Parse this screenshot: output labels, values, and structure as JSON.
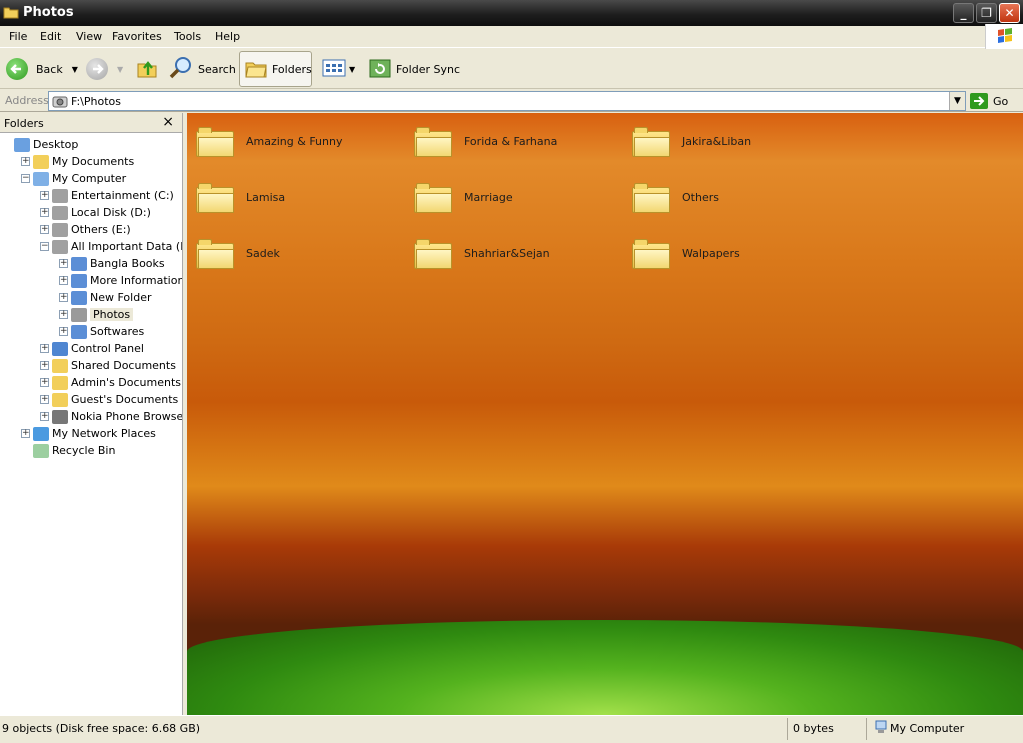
{
  "window": {
    "title": "Photos"
  },
  "menu": [
    "File",
    "Edit",
    "View",
    "Favorites",
    "Tools",
    "Help"
  ],
  "toolbar": {
    "back": "Back",
    "search": "Search",
    "folders": "Folders",
    "folder_sync": "Folder Sync"
  },
  "address": {
    "label": "Address",
    "value": "F:\\Photos",
    "go": "Go"
  },
  "folders_pane": {
    "title": "Folders",
    "close": "×",
    "tree": [
      {
        "label": "Desktop",
        "expander": "",
        "icon": "desktop-icon"
      },
      {
        "label": "My Documents",
        "expander": "+",
        "icon": "my-documents-icon"
      },
      {
        "label": "My Computer",
        "expander": "−",
        "icon": "my-computer-icon"
      },
      {
        "label": "Entertainment (C:)",
        "expander": "+",
        "icon": "drive-icon"
      },
      {
        "label": "Local Disk (D:)",
        "expander": "+",
        "icon": "drive-icon"
      },
      {
        "label": "Others (E:)",
        "expander": "+",
        "icon": "drive-icon"
      },
      {
        "label": "All Important Data (F:)",
        "expander": "−",
        "icon": "drive-icon"
      },
      {
        "label": "Bangla Books",
        "expander": "+",
        "icon": "folder-custom-icon"
      },
      {
        "label": "More Information",
        "expander": "+",
        "icon": "folder-custom-icon"
      },
      {
        "label": "New Folder",
        "expander": "+",
        "icon": "folder-custom-icon"
      },
      {
        "label": "Photos",
        "expander": "+",
        "icon": "camera-folder-icon"
      },
      {
        "label": "Softwares",
        "expander": "+",
        "icon": "folder-custom-icon"
      },
      {
        "label": "Control Panel",
        "expander": "+",
        "icon": "control-panel-icon"
      },
      {
        "label": "Shared Documents",
        "expander": "+",
        "icon": "folder-icon"
      },
      {
        "label": "Admin's Documents",
        "expander": "+",
        "icon": "folder-icon"
      },
      {
        "label": "Guest's Documents",
        "expander": "+",
        "icon": "folder-icon"
      },
      {
        "label": "Nokia Phone Browser",
        "expander": "+",
        "icon": "phone-icon"
      },
      {
        "label": "My Network Places",
        "expander": "+",
        "icon": "network-icon"
      },
      {
        "label": "Recycle Bin",
        "expander": "",
        "icon": "recycle-bin-icon"
      }
    ]
  },
  "folders": [
    "Amazing & Funny",
    "Forida & Farhana",
    "Jakira&Liban",
    "Lamisa",
    "Marriage",
    "Others",
    "Sadek",
    "Shahriar&Sejan",
    "Walpapers"
  ],
  "status": {
    "objects": "9 objects (Disk free space: 6.68 GB)",
    "size": "0 bytes",
    "location": "My Computer"
  },
  "colors": {
    "title_bar": "#1e1e1e",
    "chrome": "#ece9d8",
    "folder_yellow": "#f2d772",
    "selection": "#ece9d8"
  }
}
